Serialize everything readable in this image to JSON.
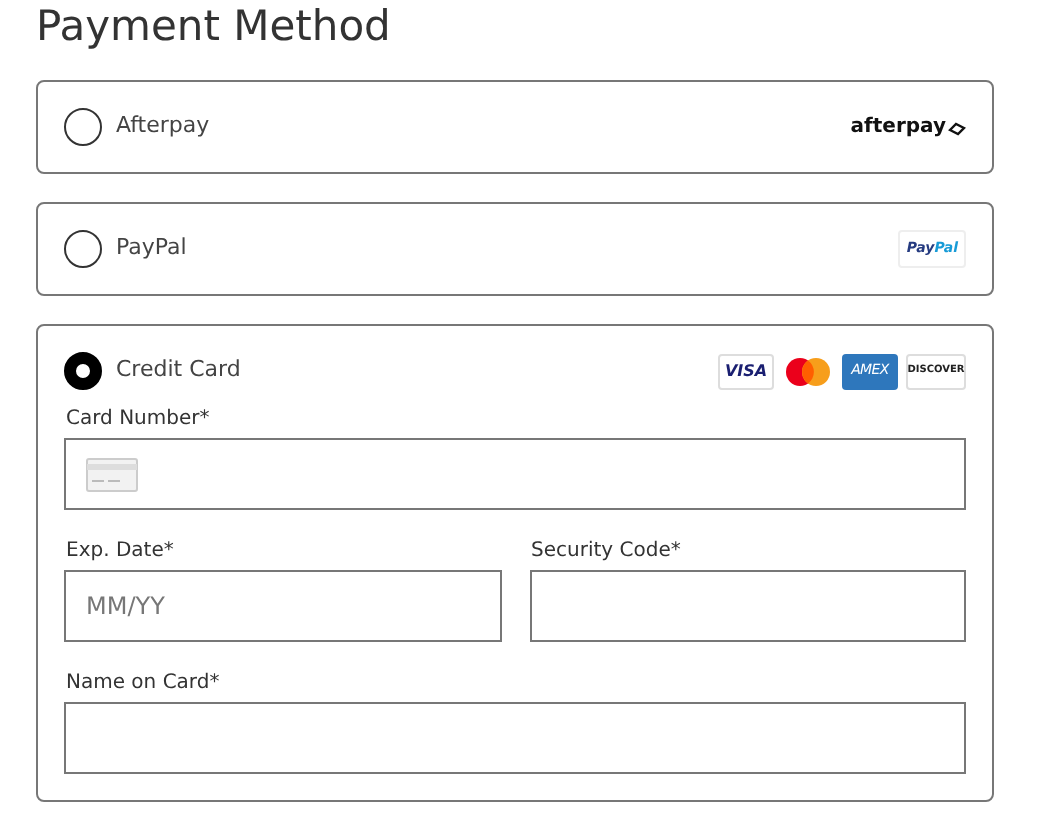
{
  "title": "Payment Method",
  "options": [
    {
      "label": "Afterpay",
      "selected": false,
      "logos": [
        {
          "kind": "afterpay",
          "text": "afterpay"
        }
      ]
    },
    {
      "label": "PayPal",
      "selected": false,
      "logos": [
        {
          "kind": "paypal",
          "text": "Pay",
          "text2": "Pal"
        }
      ]
    },
    {
      "label": "Credit Card",
      "selected": true,
      "logos": [
        {
          "kind": "visa",
          "text": "VISA"
        },
        {
          "kind": "mastercard"
        },
        {
          "kind": "amex",
          "text": "AMEX"
        },
        {
          "kind": "discover",
          "text": "DISCOVER"
        }
      ]
    }
  ],
  "card_form": {
    "rows": [
      [
        {
          "label": "Card Number*",
          "kind": "card"
        }
      ],
      [
        {
          "label": "Exp. Date*",
          "placeholder": "MM/YY"
        },
        {
          "label": "Security Code*"
        }
      ],
      [
        {
          "label": "Name on Card*"
        }
      ]
    ]
  }
}
